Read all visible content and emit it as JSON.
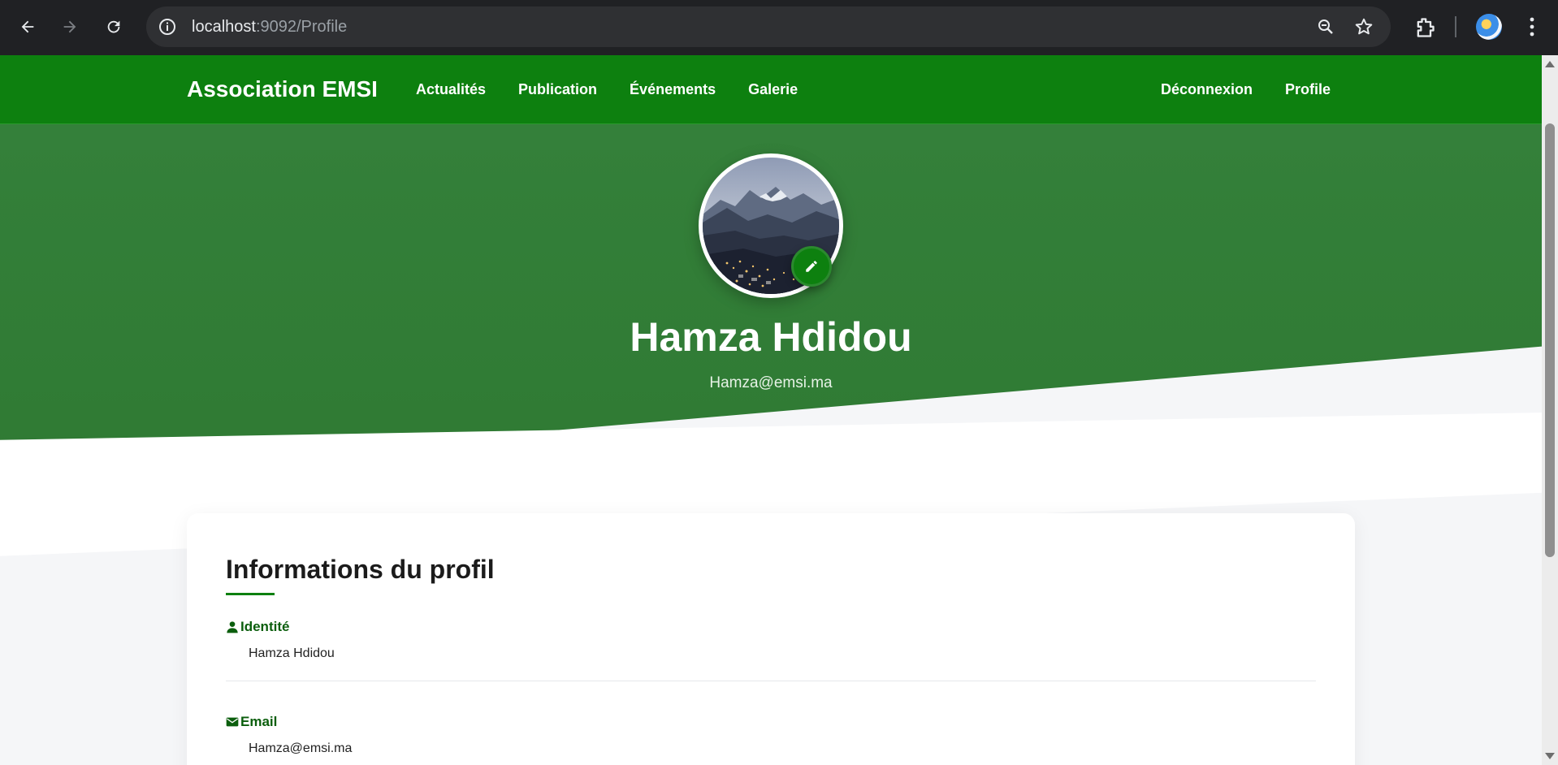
{
  "browser": {
    "url_host": "localhost",
    "url_path": ":9092/Profile"
  },
  "navbar": {
    "brand": "Association EMSI",
    "links": [
      "Actualités",
      "Publication",
      "Événements",
      "Galerie"
    ],
    "right_links": [
      "Déconnexion",
      "Profile"
    ]
  },
  "hero": {
    "name": "Hamza Hdidou",
    "email": "Hamza@emsi.ma"
  },
  "card": {
    "title": "Informations du profil",
    "fields": [
      {
        "label": "Identité",
        "value": "Hamza Hdidou",
        "icon": "user-icon"
      },
      {
        "label": "Email",
        "value": "Hamza@emsi.ma",
        "icon": "envelope-icon"
      }
    ]
  },
  "colors": {
    "brand_green": "#0d800f",
    "hero_green": "#34803a",
    "label_green": "#0b5e0d"
  }
}
